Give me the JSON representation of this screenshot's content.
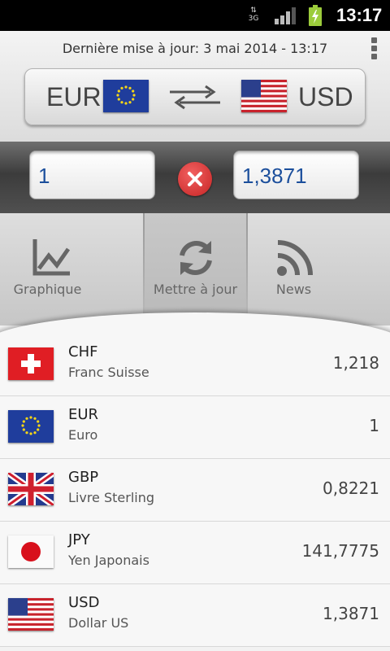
{
  "status_bar": {
    "network": "3G",
    "time": "13:17"
  },
  "header": {
    "last_update": "Dernière mise à jour: 3 mai 2014 - 13:17",
    "from_currency": "EUR",
    "to_currency": "USD"
  },
  "converter": {
    "amount": "1",
    "result": "1,3871"
  },
  "toolbar": {
    "items": [
      {
        "label": "Graphique",
        "icon": "chart-icon"
      },
      {
        "label": "Mettre à jour",
        "icon": "refresh-icon"
      },
      {
        "label": "News",
        "icon": "rss-icon"
      }
    ]
  },
  "currencies": [
    {
      "code": "CHF",
      "name": "Franc Suisse",
      "value": "1,218",
      "flag": "swiss-flag"
    },
    {
      "code": "EUR",
      "name": "Euro",
      "value": "1",
      "flag": "eu-flag"
    },
    {
      "code": "GBP",
      "name": "Livre Sterling",
      "value": "0,8221",
      "flag": "uk-flag"
    },
    {
      "code": "JPY",
      "name": "Yen Japonais",
      "value": "141,7775",
      "flag": "japan-flag"
    },
    {
      "code": "USD",
      "name": "Dollar US",
      "value": "1,3871",
      "flag": "us-flag"
    }
  ],
  "colors": {
    "accent_blue": "#1c4f9c",
    "clear_red": "#d83a3a"
  }
}
